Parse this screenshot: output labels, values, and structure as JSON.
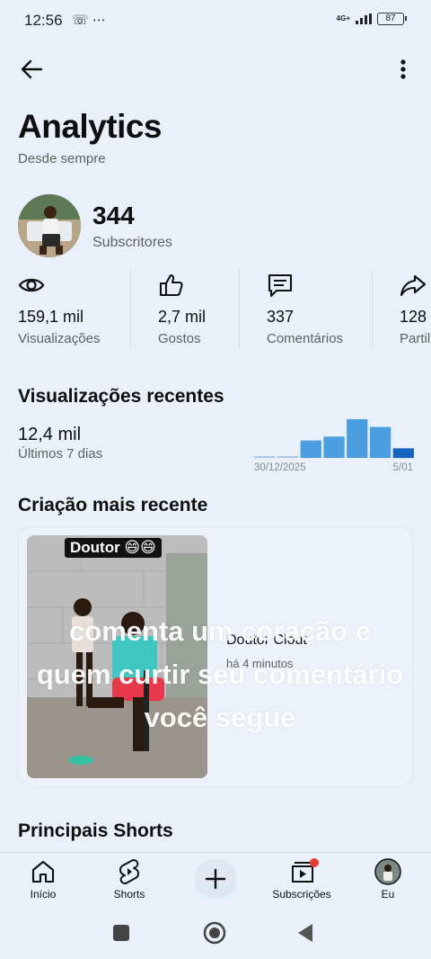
{
  "status_bar": {
    "time": "12:56",
    "left_icons": "☏ ⋯",
    "network": "4G+",
    "battery": "87"
  },
  "header": {
    "title": "Analytics",
    "subtitle": "Desde sempre"
  },
  "channel": {
    "subscribers": "344",
    "subscribers_label": "Subscritores"
  },
  "stats": [
    {
      "icon": "eye-icon",
      "value": "159,1 mil",
      "label": "Visualizações"
    },
    {
      "icon": "thumbs-up-icon",
      "value": "2,7 mil",
      "label": "Gostos"
    },
    {
      "icon": "comment-icon",
      "value": "337",
      "label": "Comentários"
    },
    {
      "icon": "share-icon",
      "value": "128",
      "label": "Partil"
    }
  ],
  "recent_views": {
    "title": "Visualizações recentes",
    "value": "12,4 mil",
    "period": "Últimos 7 dias",
    "chart_data": {
      "type": "bar",
      "categories": [
        "30/12/2025",
        "",
        "",
        "",
        "",
        "",
        "5/01"
      ],
      "values": [
        0.05,
        0.05,
        0.45,
        0.55,
        1.0,
        0.8,
        0.25
      ],
      "colors": {
        "bar": "#4b9fe1",
        "highlight": "#1565c0",
        "baseline": "#a9c9ec"
      }
    },
    "date_start": "30/12/2025",
    "date_end": "5/01"
  },
  "latest_creation": {
    "title": "Criação mais recente",
    "thumbnail_caption": "Doutor 😄😄",
    "video_title": "Doutor Clout",
    "video_time": "há 4 minutos",
    "overlay_text": "comenta um coração e quem curtir seu comentário você segue"
  },
  "top_shorts": {
    "title": "Principais Shorts"
  },
  "bottom_nav": {
    "home": "Início",
    "shorts": "Shorts",
    "subscriptions": "Subscrições",
    "you": "Eu"
  },
  "colors": {
    "background": "#e9f0f9",
    "notification_dot": "#e53935"
  }
}
